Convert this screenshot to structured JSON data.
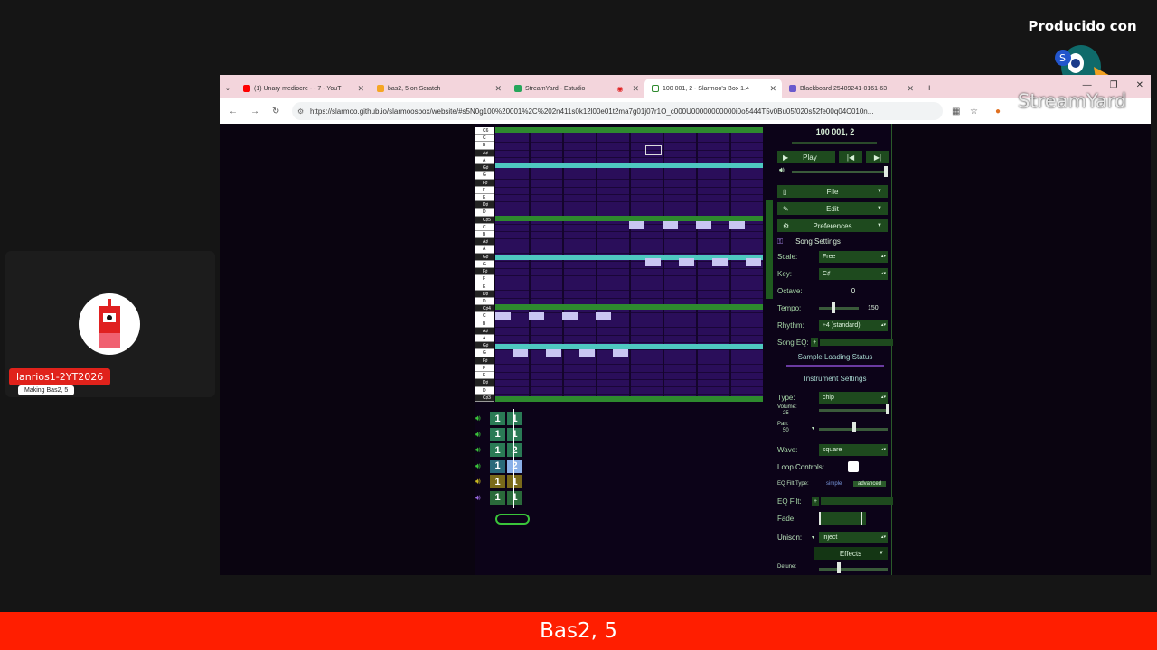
{
  "brand": {
    "produced_with": "Producido con",
    "name": "StreamYard"
  },
  "participant": {
    "name": "lanrios1-2YT2026",
    "subtitle": "Making Bas2, 5"
  },
  "browser": {
    "tabs": [
      {
        "label": "(1) Unary mediocre - - 7 - YouT",
        "color": "#ff0000"
      },
      {
        "label": "bas2, 5 on Scratch",
        "color": "#f5a623"
      },
      {
        "label": "StreamYard - Estudio",
        "color": "#26a65b"
      },
      {
        "label": "100 001, 2 - Slarmoo's Box 1.4",
        "color": "#2e8a2e"
      },
      {
        "label": "Blackboard 25489241-0161-63",
        "color": "#6a5acd"
      }
    ],
    "url": "https://slarmoo.github.io/slarmoosbox/website/#s5N0g100%20001%2C%202n411s0k12l00e01t2ma7g01j07r1O_c000U00000000000i0o5444T5v0Bu05f020s52fe00q04C010n..."
  },
  "editor": {
    "keys": [
      "C6",
      "C",
      "B",
      "A♯",
      "A",
      "G♯",
      "G",
      "F♯",
      "F",
      "E",
      "D♯",
      "D",
      "C♯5",
      "C",
      "B",
      "A♯",
      "A",
      "G♯",
      "G",
      "F♯",
      "F",
      "E",
      "D♯",
      "D",
      "C♯4",
      "C",
      "B",
      "A♯",
      "A",
      "G♯",
      "G",
      "F♯",
      "F",
      "E",
      "D♯",
      "D",
      "C♯3"
    ],
    "patterns": [
      {
        "cells": [
          "1",
          "1"
        ],
        "color": "#2a7a55",
        "spk": "#3ac43a"
      },
      {
        "cells": [
          "1",
          "1"
        ],
        "color": "#2a7a55",
        "spk": "#3ac43a"
      },
      {
        "cells": [
          "1",
          "2"
        ],
        "color": "#2a7a55",
        "spk": "#3ac43a"
      },
      {
        "cells": [
          "1",
          "2"
        ],
        "color": "#2a6a7a",
        "spk": "#3ac43a",
        "hl": true
      },
      {
        "cells": [
          "1",
          "1"
        ],
        "color": "#7a6a1a",
        "spk": "#c8b820"
      },
      {
        "cells": [
          "1",
          "1"
        ],
        "color": "#2a6a3a",
        "spk": "#9a6ae0"
      }
    ]
  },
  "panel": {
    "song_title": "100 001, 2",
    "play": "Play",
    "file": "File",
    "edit": "Edit",
    "preferences": "Preferences",
    "song_settings": "Song Settings",
    "scale_label": "Scale:",
    "scale_value": "Free",
    "key_label": "Key:",
    "key_value": "C♯",
    "octave_label": "Octave:",
    "octave_value": "0",
    "tempo_label": "Tempo:",
    "tempo_value": "150",
    "rhythm_label": "Rhythm:",
    "rhythm_value": "÷4 (standard)",
    "song_eq_label": "Song EQ:",
    "sample_loading": "Sample Loading Status",
    "instrument_settings": "Instrument Settings",
    "type_label": "Type:",
    "type_value": "chip",
    "volume_label": "Volume:",
    "volume_value": "25",
    "pan_label": "Pan:",
    "pan_value": "50",
    "wave_label": "Wave:",
    "wave_value": "square",
    "loop_label": "Loop Controls:",
    "eqfilt_type_label": "EQ Filt.Type:",
    "eqfilt_simple": "simple",
    "eqfilt_advanced": "advanced",
    "eqfilt_label": "EQ Filt:",
    "fade_label": "Fade:",
    "unison_label": "Unison:",
    "unison_value": "inject",
    "effects": "Effects",
    "detune_label": "Detune:"
  },
  "banner": {
    "title": "Bas2, 5"
  }
}
